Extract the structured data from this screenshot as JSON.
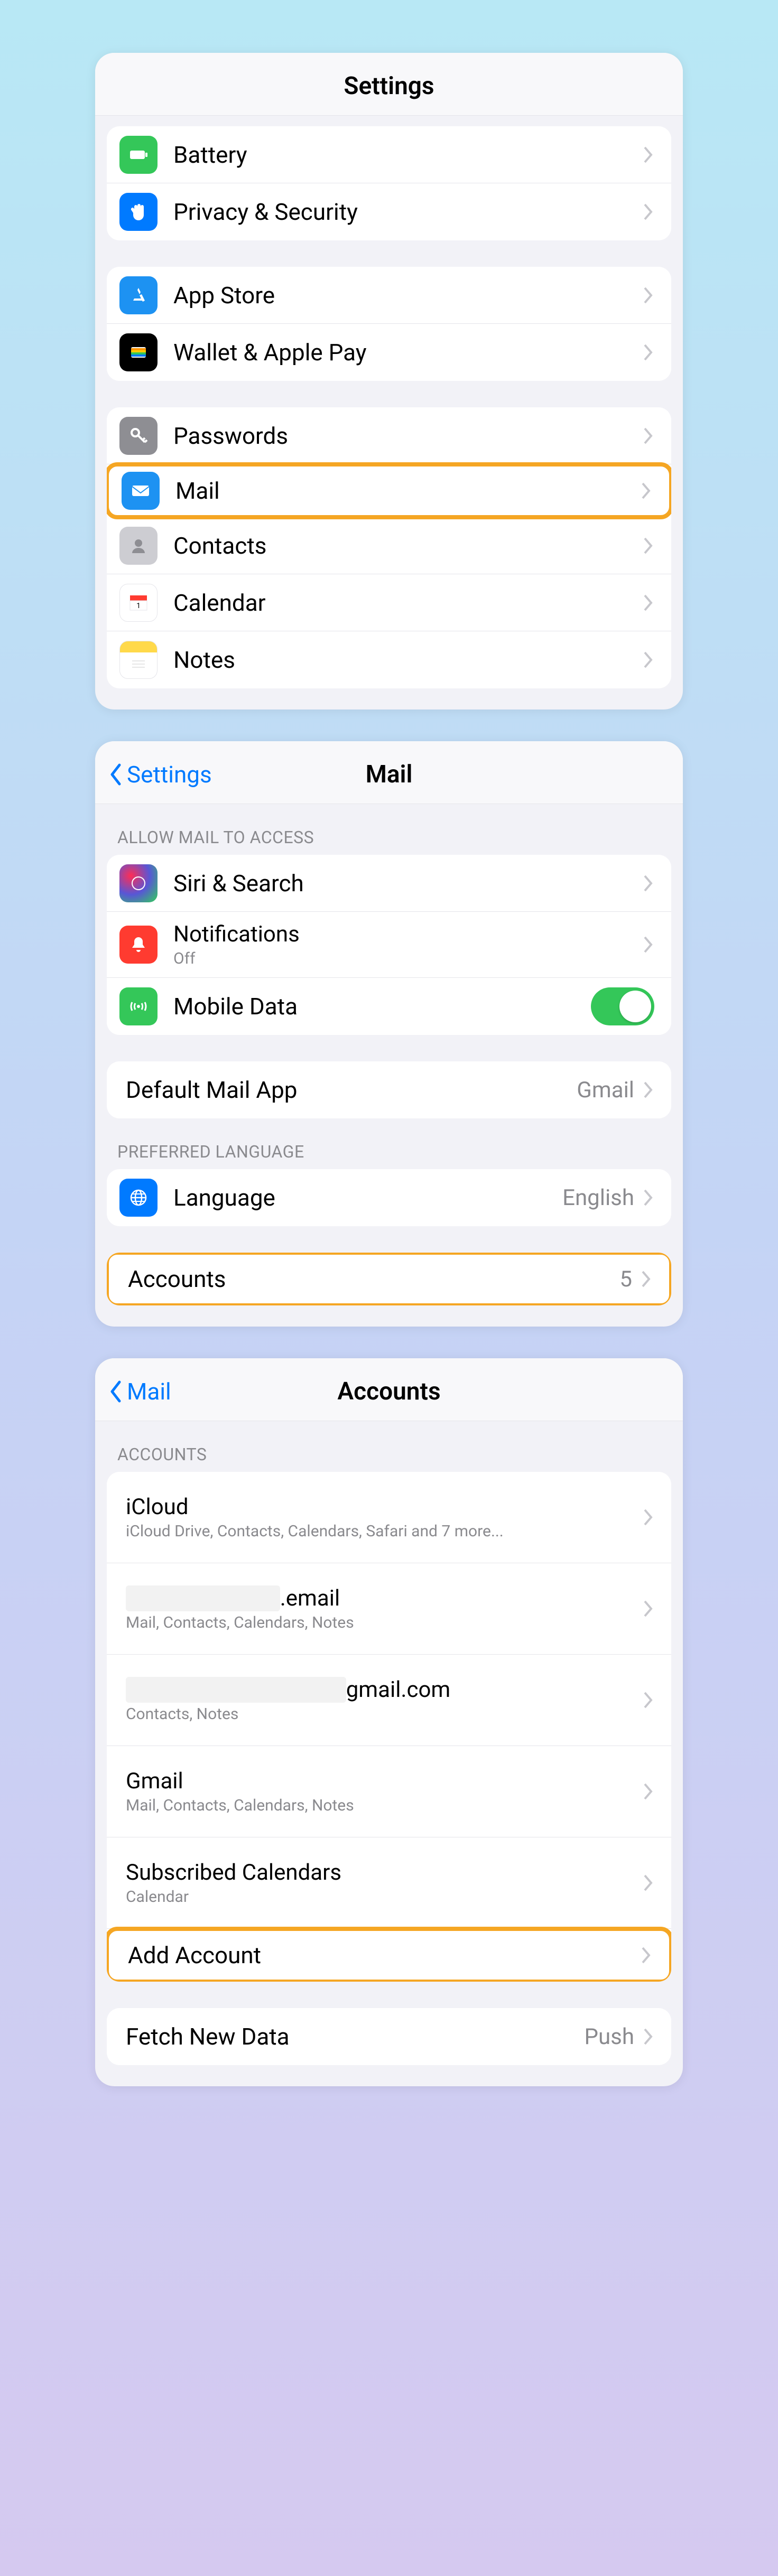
{
  "panel1": {
    "title": "Settings",
    "groupA": [
      {
        "label": "Battery",
        "icon": "battery",
        "color": "#34c759",
        "highlighted": false
      },
      {
        "label": "Privacy & Security",
        "icon": "hand",
        "color": "#007aff",
        "highlighted": false
      }
    ],
    "groupB": [
      {
        "label": "App Store",
        "icon": "appstore",
        "color": "#1d92f2",
        "highlighted": false
      },
      {
        "label": "Wallet & Apple Pay",
        "icon": "wallet",
        "color": "#000000",
        "highlighted": false
      }
    ],
    "groupC": [
      {
        "label": "Passwords",
        "icon": "key",
        "color": "#8e8e93",
        "highlighted": false
      },
      {
        "label": "Mail",
        "icon": "mail",
        "color": "#1d92f2",
        "highlighted": true
      },
      {
        "label": "Contacts",
        "icon": "contacts",
        "color": "#cdcdd2",
        "highlighted": false
      },
      {
        "label": "Calendar",
        "icon": "calendar",
        "color": "#ffffff",
        "highlighted": false
      },
      {
        "label": "Notes",
        "icon": "notes",
        "color": "#ffffff",
        "highlighted": false
      }
    ]
  },
  "panel2": {
    "back": "Settings",
    "title": "Mail",
    "accessHeader": "ALLOW MAIL TO ACCESS",
    "access": [
      {
        "label": "Siri & Search",
        "icon": "siri",
        "color": "#000000"
      },
      {
        "label": "Notifications",
        "sub": "Off",
        "icon": "bell",
        "color": "#ff3b30"
      },
      {
        "label": "Mobile Data",
        "icon": "antenna",
        "color": "#34c759",
        "toggle": true
      }
    ],
    "defaultApp": {
      "label": "Default Mail App",
      "value": "Gmail"
    },
    "langHeader": "PREFERRED LANGUAGE",
    "language": {
      "label": "Language",
      "value": "English",
      "icon": "globe",
      "color": "#007aff"
    },
    "accounts": {
      "label": "Accounts",
      "value": "5",
      "highlighted": true
    }
  },
  "panel3": {
    "back": "Mail",
    "title": "Accounts",
    "accountsHeader": "ACCOUNTS",
    "list": [
      {
        "title": "iCloud",
        "sub": "iCloud Drive, Contacts, Calendars, Safari and 7 more..."
      },
      {
        "title_prefix_redacted": true,
        "title_suffix": ".email",
        "sub": "Mail, Contacts, Calendars, Notes"
      },
      {
        "title_prefix_redacted": true,
        "title_suffix": "gmail.com",
        "sub": "Contacts, Notes"
      },
      {
        "title": "Gmail",
        "sub": "Mail, Contacts, Calendars, Notes"
      },
      {
        "title": "Subscribed Calendars",
        "sub": "Calendar"
      }
    ],
    "add": {
      "label": "Add Account",
      "highlighted": true
    },
    "fetch": {
      "label": "Fetch New Data",
      "value": "Push"
    }
  }
}
